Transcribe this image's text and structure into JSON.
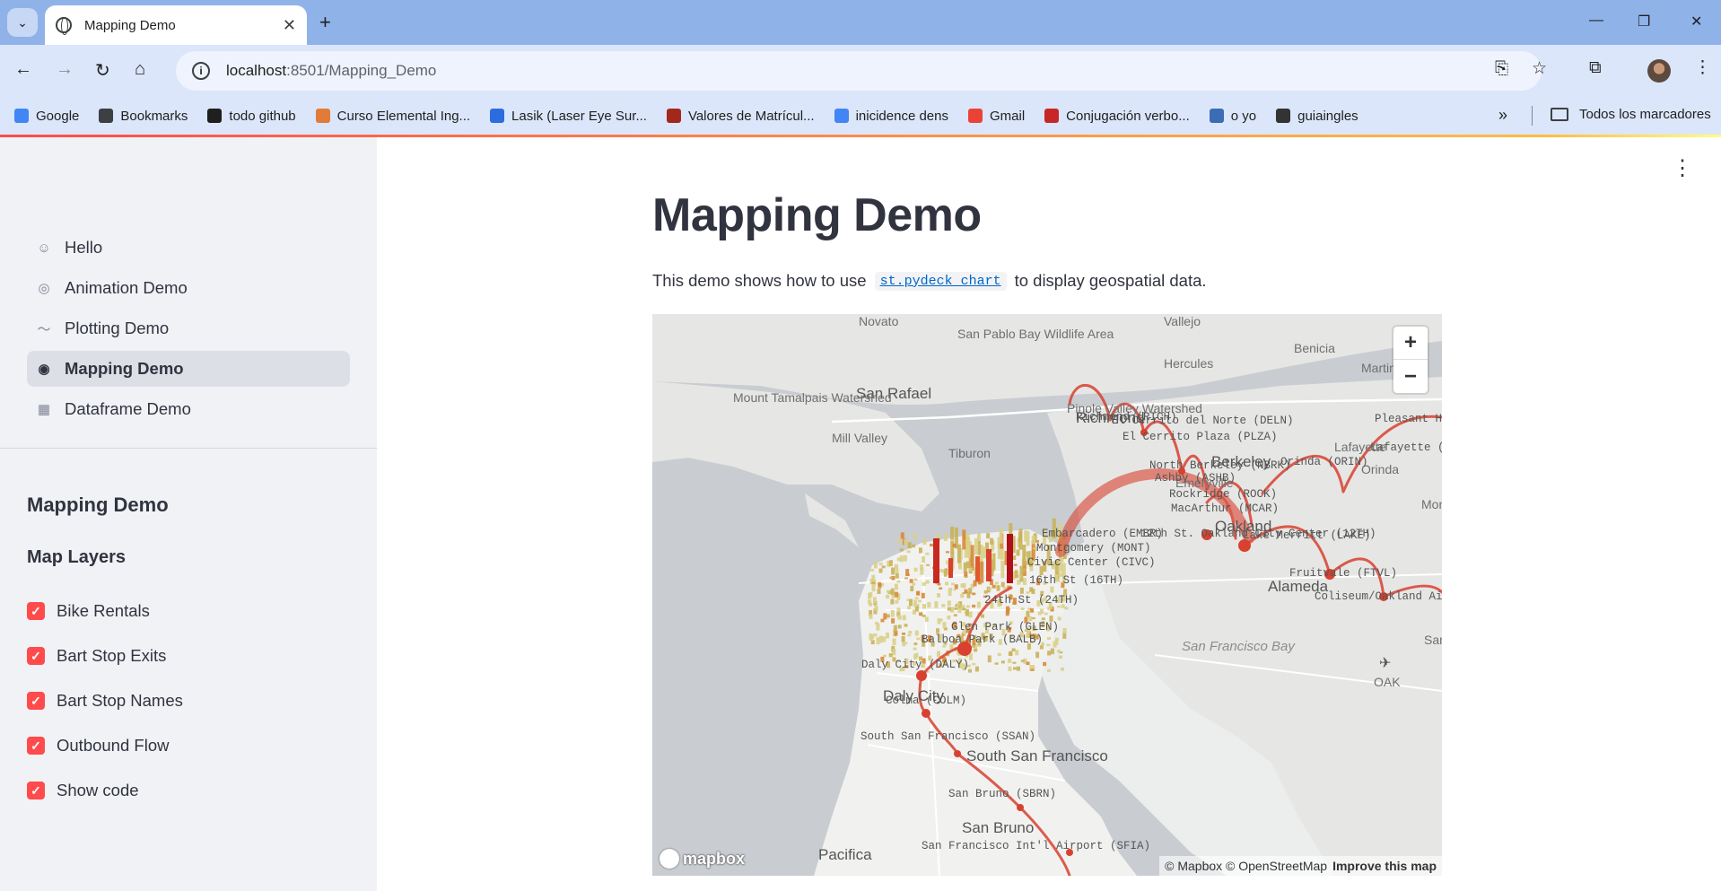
{
  "browser": {
    "tab_title": "Mapping Demo",
    "url_host": "localhost",
    "url_rest": ":8501/Mapping_Demo",
    "bookmarks": [
      {
        "label": "Google",
        "color": "#4285f4"
      },
      {
        "label": "Bookmarks",
        "color": "#3c4043"
      },
      {
        "label": "todo github",
        "color": "#1f1f1f"
      },
      {
        "label": "Curso Elemental Ing...",
        "color": "#e07b39"
      },
      {
        "label": "Lasik (Laser Eye Sur...",
        "color": "#2d6cdf"
      },
      {
        "label": "Valores de Matrícul...",
        "color": "#a3281c"
      },
      {
        "label": "inicidence dens",
        "color": "#4285f4"
      },
      {
        "label": "Gmail",
        "color": "#ea4335"
      },
      {
        "label": "Conjugación verbo...",
        "color": "#c62828"
      },
      {
        "label": "o yo",
        "color": "#3b6db5"
      },
      {
        "label": "guiaingles",
        "color": "#333333"
      }
    ],
    "all_bookmarks": "Todos los marcadores"
  },
  "sidebar": {
    "nav": [
      {
        "label": "Hello",
        "icon": "wave-icon"
      },
      {
        "label": "Animation Demo",
        "icon": "spiral-icon"
      },
      {
        "label": "Plotting Demo",
        "icon": "trend-icon"
      },
      {
        "label": "Mapping Demo",
        "icon": "globe-icon",
        "active": true
      },
      {
        "label": "Dataframe Demo",
        "icon": "table-icon"
      }
    ],
    "section_title": "Mapping Demo",
    "layers_title": "Map Layers",
    "layers": [
      {
        "label": "Bike Rentals",
        "checked": true
      },
      {
        "label": "Bart Stop Exits",
        "checked": true
      },
      {
        "label": "Bart Stop Names",
        "checked": true
      },
      {
        "label": "Outbound Flow",
        "checked": true
      },
      {
        "label": "Show code",
        "checked": true
      }
    ]
  },
  "main": {
    "title": "Mapping Demo",
    "intro_before": "This demo shows how to use",
    "intro_code": "st.pydeck_chart",
    "intro_after": "to display geospatial data."
  },
  "map": {
    "places": [
      "Novato",
      "Vallejo",
      "San Pablo Bay Wildlife Area",
      "Hercules",
      "Benicia",
      "Martinez",
      "San Rafael",
      "Mount Tamalpais Watershed",
      "Pinole Valley Watershed",
      "Richmond",
      "Mill Valley",
      "Tiburon",
      "Berkeley",
      "Orinda",
      "Lafayette",
      "Emeryville",
      "Oakland",
      "Alameda",
      "San Francisco Bay",
      "Daly City",
      "South San Francisco",
      "San Bruno",
      "Pacifica",
      "OAK",
      "Mora",
      "San L"
    ],
    "stations": [
      "Richmond (RICH)",
      "El Cerrito del Norte (DELN)",
      "El Cerrito Plaza (PLZA)",
      "North Berkeley (NBRK)",
      "Ashby (ASHB)",
      "Rockridge (ROCK)",
      "MacArthur (MCAR)",
      "12th St. Oakland City Center (12TH)",
      "Lake Merritt (LAKE)",
      "Fruitvale (FTVL)",
      "Coliseum/Oakland Airport",
      "Orinda (ORIN)",
      "Lafayette (LAFY)",
      "Pleasant Hill",
      "24th St (24TH)",
      "16th St (16TH)",
      "Civic Center (CIVC)",
      "Montgomery (MONT)",
      "Embarcadero (EMBR)",
      "Glen Park (GLEN)",
      "Balboa Park (BALB)",
      "Daly City (DALY)",
      "Colma (COLM)",
      "South San Francisco (SSAN)",
      "San Bruno (SBRN)",
      "San Francisco Int'l Airport (SFIA)"
    ],
    "zoom_in": "+",
    "zoom_out": "−",
    "logo": "mapbox",
    "attribution": "© Mapbox © OpenStreetMap",
    "improve": "Improve this map",
    "arc_color": "#d8412f",
    "hex_color": "#c9b25a"
  }
}
